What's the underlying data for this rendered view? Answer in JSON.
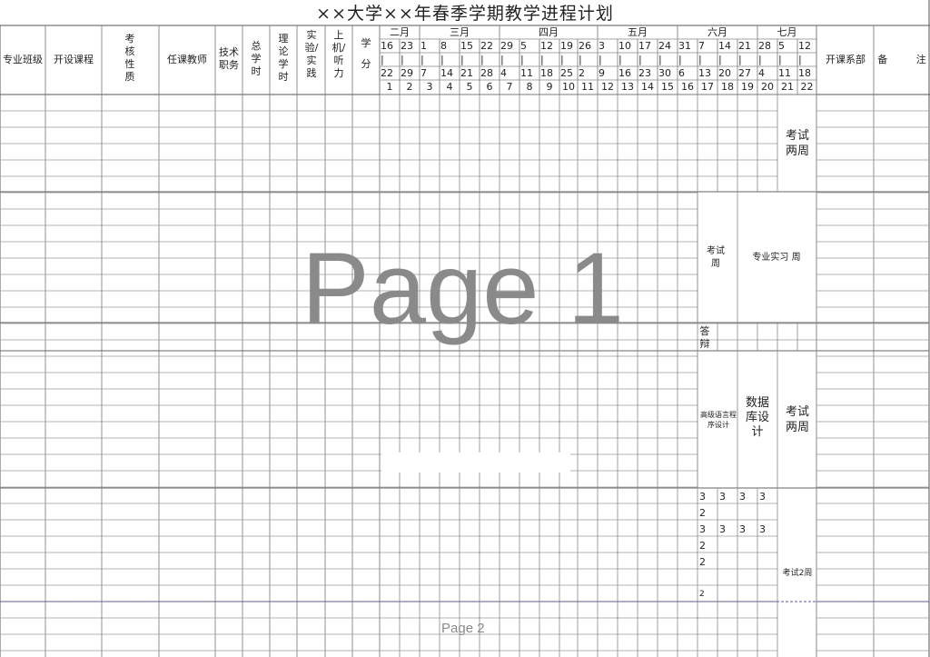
{
  "title": "××大学××年春季学期教学进程计划",
  "headers": {
    "class": "专业班级",
    "course": "开设课程",
    "assessment": "考核性质",
    "teacher": "任课教师",
    "title_rank": "技术职务",
    "total_hours": "总学时",
    "theory_hours": "理论学时",
    "practice": "实验/实践",
    "computer": "上机/听力",
    "credits": "学分",
    "department": "开课系部",
    "remarks": "备 注"
  },
  "months": [
    "二月",
    "三月",
    "四月",
    "五月",
    "六月",
    "七月"
  ],
  "week_start_days": [
    "16",
    "23",
    "1",
    "8",
    "15",
    "22",
    "29",
    "5",
    "12",
    "19",
    "26",
    "3",
    "10",
    "17",
    "24",
    "31",
    "7",
    "14",
    "21",
    "28",
    "5",
    "12"
  ],
  "week_separators": [
    "|",
    "|",
    "|",
    "|",
    "|",
    "|",
    "|",
    "|",
    "|",
    "|",
    "|",
    "|",
    "|",
    "|",
    "|",
    "|",
    "|",
    "|",
    "|",
    "|",
    "|",
    "|"
  ],
  "week_end_days": [
    "22",
    "29",
    "7",
    "14",
    "21",
    "28",
    "4",
    "11",
    "18",
    "25",
    "2",
    "9",
    "16",
    "23",
    "30",
    "6",
    "13",
    "20",
    "27",
    "4",
    "11",
    "18"
  ],
  "week_numbers": [
    "1",
    "2",
    "3",
    "4",
    "5",
    "6",
    "7",
    "8",
    "9",
    "10",
    "11",
    "12",
    "13",
    "14",
    "15",
    "16",
    "17",
    "18",
    "19",
    "20",
    "21",
    "22"
  ],
  "notes": {
    "exam_two_weeks_1": "考试两周",
    "exam_week": "考试周",
    "internship": "专业实习 周",
    "defense": "答辩",
    "adv_language": "高级语言程序设计",
    "database": "数据库设计",
    "exam_two_weeks_2": "考试两周",
    "exam_2_weeks": "考试2周"
  },
  "schedule_rows": [
    [
      "3",
      "3",
      "3",
      "3"
    ],
    [
      "2",
      "",
      "",
      ""
    ],
    [
      "3",
      "3",
      "3",
      "3"
    ],
    [
      "2",
      "",
      "",
      ""
    ],
    [
      "2",
      "",
      "",
      ""
    ],
    [
      "",
      "",
      " ",
      ""
    ],
    [
      "2",
      "",
      "",
      ""
    ]
  ],
  "watermarks": {
    "page1": "Page 1",
    "page2": "Page 2"
  }
}
